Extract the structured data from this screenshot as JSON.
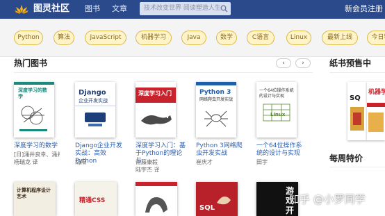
{
  "header": {
    "brand": "图灵社区",
    "nav": [
      "图书",
      "文章"
    ],
    "search_placeholder": "技术改变世界 阅读塑造人生",
    "register": "新会员注册"
  },
  "tags": [
    "Python",
    "算法",
    "JavaScript",
    "机器学习",
    "Java",
    "数学",
    "C语言",
    "Linux",
    "最新上线",
    "今日特"
  ],
  "sections": {
    "hot_books": "热门图书",
    "presale": "纸书预售中",
    "weekly_deal": "每周特价"
  },
  "books": [
    {
      "title": "深度学习的数学",
      "author": "[日]涌井良幸、涌井…",
      "translator": "杨瑞龙  译",
      "cover": {
        "heading": "深度学习的数学",
        "bg": "#ffffff",
        "accent": "#1a8a7c"
      }
    },
    {
      "title": "Django企业开发实战：高效Python",
      "author": "胡阳",
      "cover": {
        "heading": "Django",
        "subheading": "企业开发实战",
        "bg": "#ffffff",
        "accent": "#1e3f7a"
      }
    },
    {
      "title": "深度学习入门：基于Python的理论与",
      "author": "斋藤康毅",
      "translator": "陆宇杰  译",
      "cover": {
        "heading": "深度学习入门",
        "bg": "#ffffff",
        "accent": "#c8232c"
      }
    },
    {
      "title": "Python 3网络爬虫开发实战",
      "author": "崔庆才",
      "cover": {
        "heading": "Python 3",
        "subheading": "网络爬虫开发实战",
        "bg": "#ffffff",
        "accent": "#1d5fa8"
      }
    },
    {
      "title": "一个64位操作系统的设计与实现",
      "author": "田宇",
      "cover": {
        "heading": "一个64位操作系统的设计与实现",
        "subheading": "Linux",
        "bg": "#ffffff",
        "accent": "#5a8a2e"
      }
    }
  ],
  "bottom_covers": [
    {
      "heading": "计算机程序设计艺术",
      "bg": "#f3eee2"
    },
    {
      "heading": "精通CSS",
      "bg": "#f5f2ea"
    },
    {
      "heading": "",
      "bg": "#ffffff"
    },
    {
      "heading": "SQL",
      "bg": "#b8202a"
    },
    {
      "heading": "游戏开",
      "bg": "#111111"
    }
  ],
  "presale_covers": [
    {
      "heading": "SQ",
      "bg": "#ffffff"
    },
    {
      "heading": "机器学",
      "bg": "#ffffff"
    }
  ],
  "watermark": "知乎 @小罗同学",
  "colors": {
    "header": "#2b4a8c",
    "tag_bg": "#fff3c8",
    "tag_border": "#d9b84a",
    "link": "#2b5fb3"
  }
}
